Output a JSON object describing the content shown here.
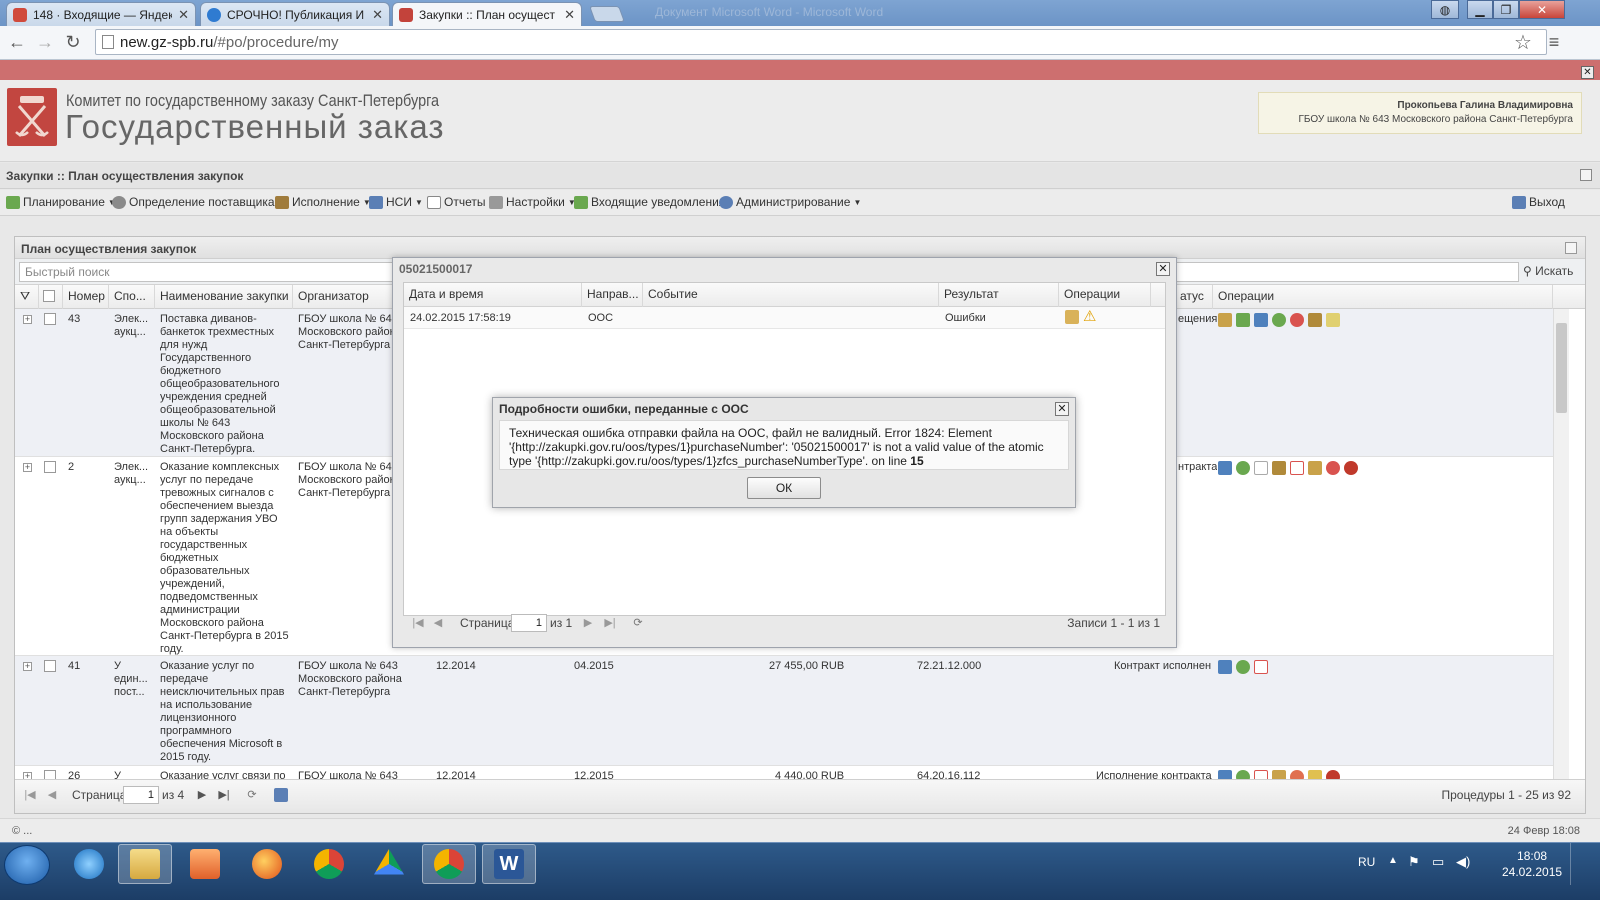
{
  "browser": {
    "tabs": [
      {
        "title": "148 · Входящие — Яндекс",
        "icon_color": "#d04a3c"
      },
      {
        "title": "СРОЧНО! Публикация И",
        "icon_color": "#2f7bd1"
      },
      {
        "title": "Закупки :: План осущест",
        "icon_color": "#c3433b"
      }
    ],
    "window_title": "Документ Microsoft Word - Microsoft Word",
    "url_domain": "new.gz-spb.ru",
    "url_path": "/#po/procedure/my",
    "icons": [
      "back-icon",
      "forward-icon",
      "reload-icon",
      "page-icon",
      "star-icon",
      "menu-icon"
    ]
  },
  "header": {
    "org": "Комитет по государственному заказу Санкт-Петербурга",
    "brand": "Государственный заказ",
    "user_name": "Прокопьева Галина Владимировна",
    "user_org": "ГБОУ школа № 643 Московского района Санкт-Петербурга"
  },
  "breadcrumb": "Закупки :: План осуществления закупок",
  "menu": {
    "items": [
      {
        "label": "Планирование",
        "dropdown": true,
        "icon_color": "#6aa84f"
      },
      {
        "label": "Определение поставщика",
        "dropdown": true,
        "icon_color": "#8a8a8a"
      },
      {
        "label": "Исполнение",
        "dropdown": true,
        "icon_color": "#a07c3c"
      },
      {
        "label": "НСИ",
        "dropdown": true,
        "icon_color": "#5b7fb5"
      },
      {
        "label": "Отчеты",
        "dropdown": false,
        "icon_color": "#8a8a8a"
      },
      {
        "label": "Настройки",
        "dropdown": true,
        "icon_color": "#888"
      },
      {
        "label": "Входящие уведомления",
        "dropdown": false,
        "icon_color": "#6aa84f"
      },
      {
        "label": "Администрирование",
        "dropdown": true,
        "icon_color": "#5b7fb5"
      }
    ],
    "logout": "Выход"
  },
  "panel": {
    "title": "План осуществления закупок",
    "search_placeholder": "Быстрый поиск",
    "search_button": "Искать",
    "columns": [
      "Номер",
      "Спо...",
      "Наименование закупки",
      "Организатор",
      "атус",
      "Операции"
    ],
    "rows": [
      {
        "num": "43",
        "method": "Элек...\nаукц...",
        "name": "Поставка диванов-\nбанкеток трехместных\nдля нужд\nГосударственного\nбюджетного\nобщеобразовательного\nучреждения средней\nобщеобразовательной\nшколы № 643\nМосковского района\nСанкт-Петербурга.",
        "org": "ГБОУ школа № 643\nМосковского район\nСанкт-Петербурга",
        "date1": "",
        "date2": "",
        "sum": "",
        "okpd": "",
        "status": "ещения",
        "ops": [
          "#c9a24a",
          "#6aa84f",
          "#4f81bd",
          "#6aa84f",
          "#d9534f",
          "#b08a3a",
          "#e0d070"
        ]
      },
      {
        "num": "2",
        "method": "Элек...\nаукц...",
        "name": "Оказание комплексных\nуслуг по передаче\nтревожных сигналов с\nобеспечением выезда\nгрупп задержания УВО\nна объекты\nгосударственных\nбюджетных\nобразовательных\nучреждений,\nподведомственных\nадминистрации\nМосковского района\nСанкт-Петербурга в 2015\nгоду.",
        "org": "ГБОУ школа № 643\nМосковского район\nСанкт-Петербурга",
        "date1": "",
        "date2": "",
        "sum": "",
        "okpd": "",
        "status": "нтракта",
        "ops": [
          "#4f81bd",
          "#6aa84f",
          "#bbbbbb",
          "#b08a3a",
          "#d9534f",
          "#c9a24a",
          "#d9534f",
          "#c0392b"
        ]
      },
      {
        "num": "41",
        "method": "У\nедин...\nпост...",
        "name": "Оказание услуг по\nпередаче\nнеисключительных прав\nна использование\nлицензионного\nпрограммного\nобеспечения Microsoft в\n2015 году.",
        "org": "ГБОУ школа № 643\nМосковского района\nСанкт-Петербурга",
        "date1": "12.2014",
        "date2": "04.2015",
        "sum": "27 455,00 RUB",
        "okpd": "72.21.12.000",
        "status": "Контракт исполнен",
        "ops": [
          "#4f81bd",
          "#6aa84f",
          "#d9534f"
        ]
      },
      {
        "num": "26",
        "method": "У",
        "name": "Оказание услуг связи по",
        "org": "ГБОУ школа № 643",
        "date1": "12.2014",
        "date2": "12.2015",
        "sum": "4 440,00 RUB",
        "okpd": "64.20.16.112",
        "status": "Исполнение контракта",
        "ops": [
          "#4f81bd",
          "#6aa84f",
          "#d9534f",
          "#c9a24a",
          "#e07050",
          "#e0c050",
          "#c0392b"
        ]
      }
    ],
    "pager": {
      "page_label": "Страница",
      "page": "1",
      "of": "из 4",
      "summary": "Процедуры 1 - 25 из 92"
    }
  },
  "event_window": {
    "title": "05021500017",
    "columns": [
      "Дата и время",
      "Направ...",
      "Событие",
      "Результат",
      "Операции"
    ],
    "row": {
      "datetime": "24.02.2015 17:58:19",
      "direction": "ООС",
      "event": "",
      "result": "Ошибки"
    },
    "pager": {
      "page_label": "Страница",
      "page": "1",
      "of": "из 1",
      "summary": "Записи 1 - 1 из 1"
    }
  },
  "error_dialog": {
    "title": "Подробности ошибки, переданные с ООС",
    "message": "Техническая ошибка отправки файла на ООС, файл не валидный. Error 1824: Element '{http://zakupki.gov.ru/oos/types/1}purchaseNumber': '05021500017' is not a valid value of the atomic type '{http://zakupki.gov.ru/oos/types/1}zfcs_purchaseNumberType'. on line",
    "line": "15",
    "ok": "ОК"
  },
  "statusbar": {
    "left": "© ...",
    "right": "24 Февр 18:08"
  },
  "taskbar": {
    "apps": [
      "ie",
      "explorer",
      "media-player",
      "firefox",
      "chrome",
      "google-drive",
      "chrome-active",
      "word"
    ],
    "lang": "RU",
    "time": "18:08",
    "date": "24.02.2015"
  }
}
